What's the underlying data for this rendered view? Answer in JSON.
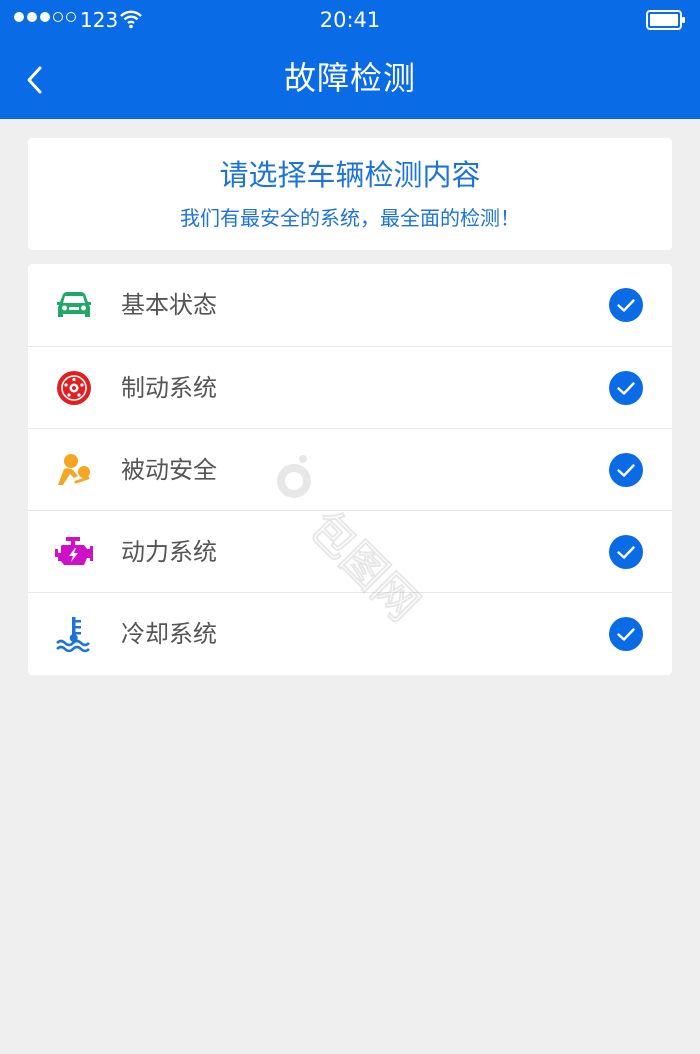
{
  "status_bar": {
    "carrier": "123",
    "time": "20:41"
  },
  "nav": {
    "title": "故障检测"
  },
  "intro": {
    "title": "请选择车辆检测内容",
    "subtitle": "我们有最安全的系统，最全面的检测！"
  },
  "items": [
    {
      "label": "基本状态",
      "icon": "car-icon",
      "color": "#1fa868",
      "checked": true
    },
    {
      "label": "制动系统",
      "icon": "brake-disc-icon",
      "color": "#e02020",
      "checked": true
    },
    {
      "label": "被动安全",
      "icon": "airbag-icon",
      "color": "#f5a623",
      "checked": true
    },
    {
      "label": "动力系统",
      "icon": "engine-icon",
      "color": "#d010c8",
      "checked": true
    },
    {
      "label": "冷却系统",
      "icon": "coolant-temperature-icon",
      "color": "#1d74d6",
      "checked": true
    }
  ],
  "colors": {
    "header": "#0a6be6",
    "accent": "#1d74d6",
    "check": "#0a6be6",
    "background": "#efefef"
  },
  "watermark": {
    "text": "包图网"
  }
}
